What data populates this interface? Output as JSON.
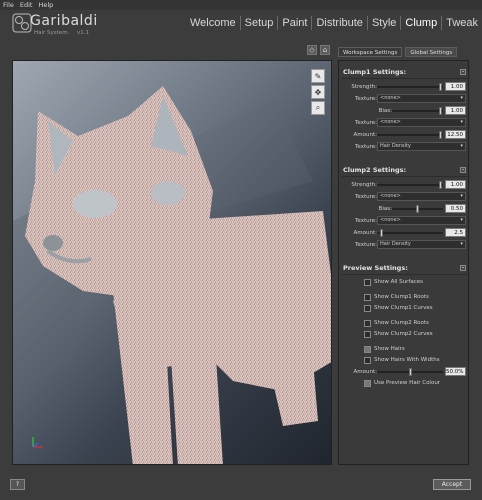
{
  "menu": {
    "file": "File",
    "edit": "Edit",
    "help": "Help"
  },
  "logo": {
    "name": "Garibaldi",
    "subtitle": "Hair System.",
    "version": "v1.1"
  },
  "nav": {
    "tabs": [
      "Welcome",
      "Setup",
      "Paint",
      "Distribute",
      "Style",
      "Clump",
      "Tweak"
    ],
    "active": "Clump"
  },
  "viewport": {
    "tools": [
      "brush-icon",
      "move-icon",
      "zoom-icon"
    ]
  },
  "panel_tabs": {
    "workspace": "Workspace Settings",
    "global": "Global Settings"
  },
  "clump1": {
    "title": "Clump1 Settings:",
    "strength_label": "Strength:",
    "strength_value": "1.00",
    "strength_level": 0.98,
    "texture_label": "Texture:",
    "texture_value": "<none>",
    "bias_label": "Bias:",
    "bias_value": "1.00",
    "bias_level": 0.98,
    "texture2_label": "Texture:",
    "texture2_value": "<none>",
    "amount_label": "Amount:",
    "amount_value": "12.50",
    "amount_level": 0.98,
    "texture3_label": "Texture:",
    "texture3_value": "Hair Density"
  },
  "clump2": {
    "title": "Clump2 Settings:",
    "strength_label": "Strength:",
    "strength_value": "1.00",
    "strength_level": 0.98,
    "texture_label": "Texture:",
    "texture_value": "<none>",
    "bias_label": "Bias:",
    "bias_value": "0.50",
    "bias_level": 0.5,
    "texture2_label": "Texture:",
    "texture2_value": "<none>",
    "amount_label": "Amount:",
    "amount_value": "2.5",
    "amount_level": 0.05,
    "texture3_label": "Texture:",
    "texture3_value": "Hair Density"
  },
  "preview": {
    "title": "Preview Settings:",
    "show_all_surfaces": "Show All Surfaces",
    "show_clump1_roots": "Show Clump1 Roots",
    "show_clump1_curves": "Show Clump1 Curves",
    "show_clump2_roots": "Show Clump2 Roots",
    "show_clump2_curves": "Show Clump2 Curves",
    "show_hairs": "Show Hairs",
    "show_hairs_widths": "Show Hairs With Widths",
    "amount_label": "Amount:",
    "amount_value": "50.0%",
    "amount_level": 0.5,
    "use_preview_colour": "Use Preview Hair Colour",
    "checked": {
      "show_hairs": true,
      "use_preview_colour": true
    }
  },
  "footer": {
    "help": "?",
    "accept": "Accept"
  }
}
